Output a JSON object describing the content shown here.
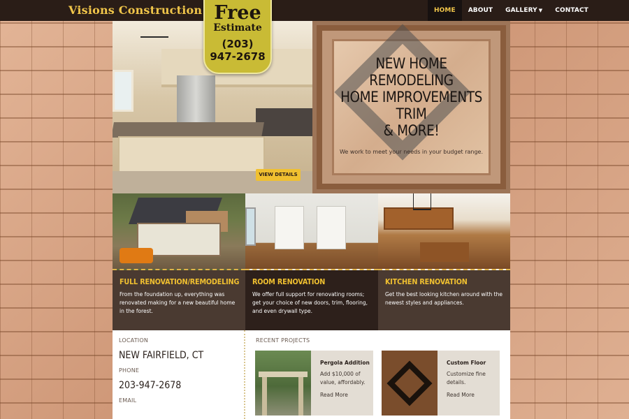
{
  "brand": "Visions Construction",
  "nav": [
    {
      "label": "HOME",
      "active": true
    },
    {
      "label": "ABOUT",
      "active": false
    },
    {
      "label": "GALLERY",
      "active": false,
      "dropdown": true
    },
    {
      "label": "CONTACT",
      "active": false
    }
  ],
  "estimate": {
    "line1": "Free",
    "line2": "Estimate",
    "phone": "(203)\n947-2678"
  },
  "hero": {
    "button": "VIEW DETAILS",
    "headline": "NEW HOME\nREMODELING\nHOME IMPROVEMENTS\nTRIM\n& MORE!",
    "subtext": "We work to meet your needs in your budget range."
  },
  "services": [
    {
      "title": "FULL RENOVATION/REMODELING",
      "text": "From the foundation up, everything was renovated making for a new beautiful home in the forest."
    },
    {
      "title": "ROOM RENOVATION",
      "text": "We offer full support for renovating rooms; get your choice of new doors, trim, flooring, and even drywall type."
    },
    {
      "title": "KITCHEN RENOVATION",
      "text": "Get the best looking kitchen around with the newest styles and appliances."
    }
  ],
  "contact": {
    "location_label": "LOCATION",
    "location": "NEW FAIRFIELD, CT",
    "phone_label": "PHONE",
    "phone": "203-947-2678",
    "email_label": "EMAIL"
  },
  "projects": {
    "heading": "RECENT PROJECTS",
    "items": [
      {
        "title": "Pergola Addition",
        "text": "Add $10,000 of value, affordably.",
        "link": "Read More"
      },
      {
        "title": "Custom Floor",
        "text": "Customize fine details.",
        "link": "Read More"
      }
    ]
  },
  "colors": {
    "accent": "#f0c030",
    "dark": "#2a1d17",
    "badge": "#c9bb35"
  }
}
